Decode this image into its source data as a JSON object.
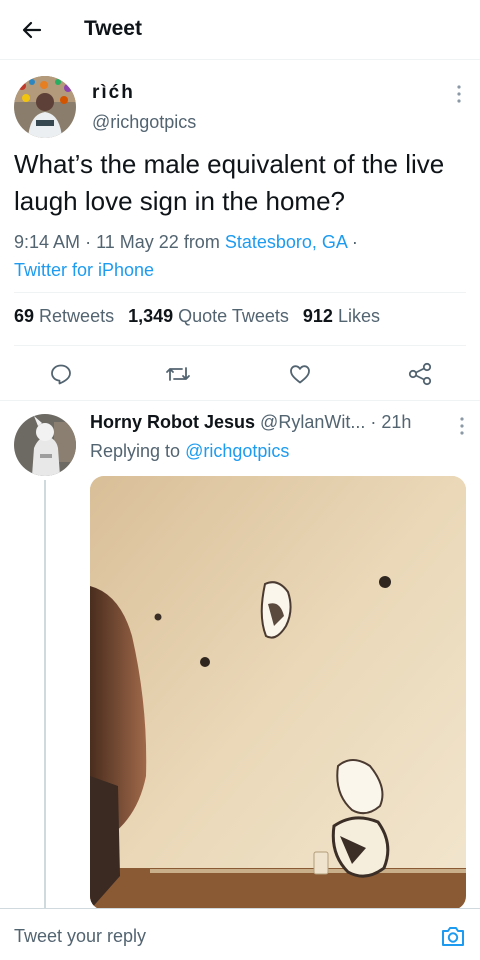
{
  "header": {
    "title": "Tweet",
    "back_icon": "arrow-left-icon"
  },
  "tweet": {
    "author_name": "rìćh",
    "author_handle": "@richgotpics",
    "text": "What’s the male equivalent of the live laugh love sign in the home?",
    "time": "9:14 AM",
    "date": "11 May 22",
    "from_word": "from",
    "location": "Statesboro, GA",
    "separator": "·",
    "source": "Twitter for iPhone",
    "stats": {
      "retweets_count": "69",
      "retweets_label": "Retweets",
      "quotes_count": "1,349",
      "quotes_label": "Quote Tweets",
      "likes_count": "912",
      "likes_label": "Likes"
    }
  },
  "actions": [
    "reply-icon",
    "retweet-icon",
    "like-icon",
    "share-icon"
  ],
  "reply": {
    "author_name": "Horny Robot Jesus",
    "author_handle": "@RylanWit...",
    "dot": "·",
    "age": "21h",
    "replying_prefix": "Replying to",
    "replying_to": "@richgotpics"
  },
  "composer": {
    "placeholder": "Tweet your reply",
    "camera_icon": "camera-icon"
  },
  "colors": {
    "link": "#1d9bf0",
    "secondary_text": "#536471",
    "primary_text": "#0f1419",
    "divider": "#eff3f4"
  }
}
